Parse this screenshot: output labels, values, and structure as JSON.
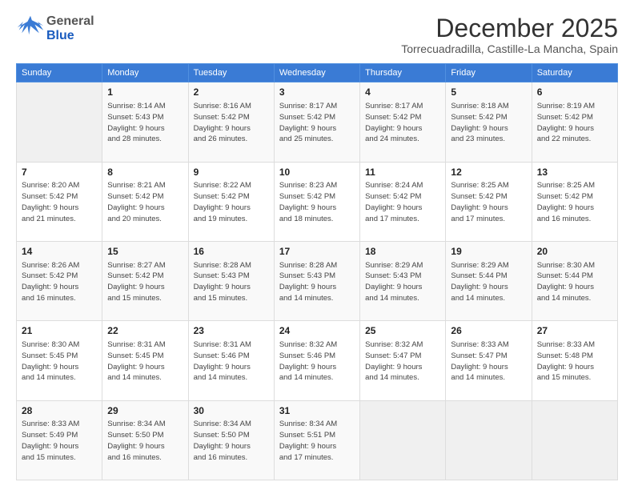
{
  "header": {
    "logo": {
      "general": "General",
      "blue": "Blue"
    },
    "title": "December 2025",
    "subtitle": "Torrecuadradilla, Castille-La Mancha, Spain"
  },
  "columns": [
    "Sunday",
    "Monday",
    "Tuesday",
    "Wednesday",
    "Thursday",
    "Friday",
    "Saturday"
  ],
  "weeks": [
    [
      {
        "day": "",
        "lines": []
      },
      {
        "day": "1",
        "lines": [
          "Sunrise: 8:14 AM",
          "Sunset: 5:43 PM",
          "Daylight: 9 hours",
          "and 28 minutes."
        ]
      },
      {
        "day": "2",
        "lines": [
          "Sunrise: 8:16 AM",
          "Sunset: 5:42 PM",
          "Daylight: 9 hours",
          "and 26 minutes."
        ]
      },
      {
        "day": "3",
        "lines": [
          "Sunrise: 8:17 AM",
          "Sunset: 5:42 PM",
          "Daylight: 9 hours",
          "and 25 minutes."
        ]
      },
      {
        "day": "4",
        "lines": [
          "Sunrise: 8:17 AM",
          "Sunset: 5:42 PM",
          "Daylight: 9 hours",
          "and 24 minutes."
        ]
      },
      {
        "day": "5",
        "lines": [
          "Sunrise: 8:18 AM",
          "Sunset: 5:42 PM",
          "Daylight: 9 hours",
          "and 23 minutes."
        ]
      },
      {
        "day": "6",
        "lines": [
          "Sunrise: 8:19 AM",
          "Sunset: 5:42 PM",
          "Daylight: 9 hours",
          "and 22 minutes."
        ]
      }
    ],
    [
      {
        "day": "7",
        "lines": [
          "Sunrise: 8:20 AM",
          "Sunset: 5:42 PM",
          "Daylight: 9 hours",
          "and 21 minutes."
        ]
      },
      {
        "day": "8",
        "lines": [
          "Sunrise: 8:21 AM",
          "Sunset: 5:42 PM",
          "Daylight: 9 hours",
          "and 20 minutes."
        ]
      },
      {
        "day": "9",
        "lines": [
          "Sunrise: 8:22 AM",
          "Sunset: 5:42 PM",
          "Daylight: 9 hours",
          "and 19 minutes."
        ]
      },
      {
        "day": "10",
        "lines": [
          "Sunrise: 8:23 AM",
          "Sunset: 5:42 PM",
          "Daylight: 9 hours",
          "and 18 minutes."
        ]
      },
      {
        "day": "11",
        "lines": [
          "Sunrise: 8:24 AM",
          "Sunset: 5:42 PM",
          "Daylight: 9 hours",
          "and 17 minutes."
        ]
      },
      {
        "day": "12",
        "lines": [
          "Sunrise: 8:25 AM",
          "Sunset: 5:42 PM",
          "Daylight: 9 hours",
          "and 17 minutes."
        ]
      },
      {
        "day": "13",
        "lines": [
          "Sunrise: 8:25 AM",
          "Sunset: 5:42 PM",
          "Daylight: 9 hours",
          "and 16 minutes."
        ]
      }
    ],
    [
      {
        "day": "14",
        "lines": [
          "Sunrise: 8:26 AM",
          "Sunset: 5:42 PM",
          "Daylight: 9 hours",
          "and 16 minutes."
        ]
      },
      {
        "day": "15",
        "lines": [
          "Sunrise: 8:27 AM",
          "Sunset: 5:42 PM",
          "Daylight: 9 hours",
          "and 15 minutes."
        ]
      },
      {
        "day": "16",
        "lines": [
          "Sunrise: 8:28 AM",
          "Sunset: 5:43 PM",
          "Daylight: 9 hours",
          "and 15 minutes."
        ]
      },
      {
        "day": "17",
        "lines": [
          "Sunrise: 8:28 AM",
          "Sunset: 5:43 PM",
          "Daylight: 9 hours",
          "and 14 minutes."
        ]
      },
      {
        "day": "18",
        "lines": [
          "Sunrise: 8:29 AM",
          "Sunset: 5:43 PM",
          "Daylight: 9 hours",
          "and 14 minutes."
        ]
      },
      {
        "day": "19",
        "lines": [
          "Sunrise: 8:29 AM",
          "Sunset: 5:44 PM",
          "Daylight: 9 hours",
          "and 14 minutes."
        ]
      },
      {
        "day": "20",
        "lines": [
          "Sunrise: 8:30 AM",
          "Sunset: 5:44 PM",
          "Daylight: 9 hours",
          "and 14 minutes."
        ]
      }
    ],
    [
      {
        "day": "21",
        "lines": [
          "Sunrise: 8:30 AM",
          "Sunset: 5:45 PM",
          "Daylight: 9 hours",
          "and 14 minutes."
        ]
      },
      {
        "day": "22",
        "lines": [
          "Sunrise: 8:31 AM",
          "Sunset: 5:45 PM",
          "Daylight: 9 hours",
          "and 14 minutes."
        ]
      },
      {
        "day": "23",
        "lines": [
          "Sunrise: 8:31 AM",
          "Sunset: 5:46 PM",
          "Daylight: 9 hours",
          "and 14 minutes."
        ]
      },
      {
        "day": "24",
        "lines": [
          "Sunrise: 8:32 AM",
          "Sunset: 5:46 PM",
          "Daylight: 9 hours",
          "and 14 minutes."
        ]
      },
      {
        "day": "25",
        "lines": [
          "Sunrise: 8:32 AM",
          "Sunset: 5:47 PM",
          "Daylight: 9 hours",
          "and 14 minutes."
        ]
      },
      {
        "day": "26",
        "lines": [
          "Sunrise: 8:33 AM",
          "Sunset: 5:47 PM",
          "Daylight: 9 hours",
          "and 14 minutes."
        ]
      },
      {
        "day": "27",
        "lines": [
          "Sunrise: 8:33 AM",
          "Sunset: 5:48 PM",
          "Daylight: 9 hours",
          "and 15 minutes."
        ]
      }
    ],
    [
      {
        "day": "28",
        "lines": [
          "Sunrise: 8:33 AM",
          "Sunset: 5:49 PM",
          "Daylight: 9 hours",
          "and 15 minutes."
        ]
      },
      {
        "day": "29",
        "lines": [
          "Sunrise: 8:34 AM",
          "Sunset: 5:50 PM",
          "Daylight: 9 hours",
          "and 16 minutes."
        ]
      },
      {
        "day": "30",
        "lines": [
          "Sunrise: 8:34 AM",
          "Sunset: 5:50 PM",
          "Daylight: 9 hours",
          "and 16 minutes."
        ]
      },
      {
        "day": "31",
        "lines": [
          "Sunrise: 8:34 AM",
          "Sunset: 5:51 PM",
          "Daylight: 9 hours",
          "and 17 minutes."
        ]
      },
      {
        "day": "",
        "lines": []
      },
      {
        "day": "",
        "lines": []
      },
      {
        "day": "",
        "lines": []
      }
    ]
  ]
}
